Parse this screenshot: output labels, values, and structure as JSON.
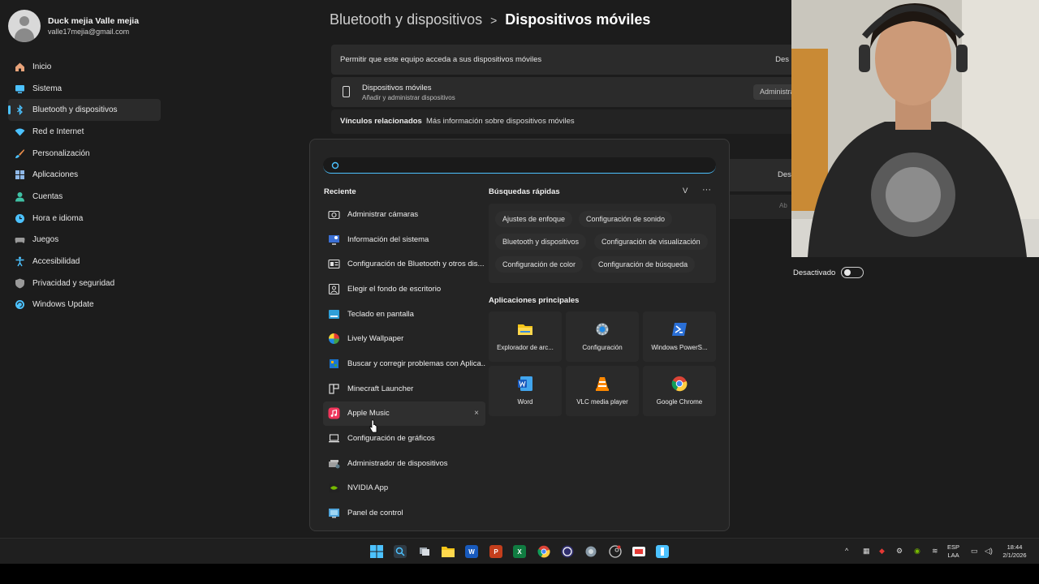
{
  "profile": {
    "name": "Duck mejia Valle mejia",
    "email": "valle17mejia@gmail.com"
  },
  "sidebar": {
    "items": [
      {
        "label": "Inicio",
        "icon": "home-icon",
        "color": "#e8a37a"
      },
      {
        "label": "Sistema",
        "icon": "system-icon",
        "color": "#4cc2ff"
      },
      {
        "label": "Bluetooth y dispositivos",
        "icon": "bluetooth-icon",
        "color": "#4cc2ff"
      },
      {
        "label": "Red e Internet",
        "icon": "wifi-icon",
        "color": "#4cc2ff"
      },
      {
        "label": "Personalización",
        "icon": "brush-icon",
        "color": "#e88c4a"
      },
      {
        "label": "Aplicaciones",
        "icon": "apps-icon",
        "color": "#8fb8e8"
      },
      {
        "label": "Cuentas",
        "icon": "account-icon",
        "color": "#3fc1a5"
      },
      {
        "label": "Hora e idioma",
        "icon": "globe-clock-icon",
        "color": "#4cc2ff"
      },
      {
        "label": "Juegos",
        "icon": "gamepad-icon",
        "color": "#9a9a9a"
      },
      {
        "label": "Accesibilidad",
        "icon": "accessibility-icon",
        "color": "#4cc2ff"
      },
      {
        "label": "Privacidad y seguridad",
        "icon": "shield-icon",
        "color": "#9a9a9a"
      },
      {
        "label": "Windows Update",
        "icon": "update-icon",
        "color": "#4cc2ff"
      }
    ]
  },
  "main": {
    "breadcrumb_parent": "Bluetooth y dispositivos",
    "breadcrumb_sep": ">",
    "title": "Dispositivos móviles",
    "allow_text": "Permitir que este equipo acceda a sus dispositivos móviles",
    "allow_state": "Des",
    "devices_title": "Dispositivos móviles",
    "devices_sub": "Añadir y administrar dispositivos",
    "manage_button": "Administrar",
    "related_label": "Vínculos relacionados",
    "related_link": "Más información sobre dispositivos móviles",
    "card_a_state": "Des",
    "card_b_text": "Ab",
    "deactivated": "Desactivado"
  },
  "search": {
    "placeholder": "",
    "recent_title": "Reciente",
    "recent": [
      {
        "label": "Administrar cámaras",
        "icon": "camera-icon"
      },
      {
        "label": "Información del sistema",
        "icon": "system-info-icon"
      },
      {
        "label": "Configuración de Bluetooth y otros dis...",
        "icon": "bluetooth-settings-icon"
      },
      {
        "label": "Elegir el fondo de escritorio",
        "icon": "wallpaper-icon"
      },
      {
        "label": "Teclado en pantalla",
        "icon": "keyboard-icon"
      },
      {
        "label": "Lively Wallpaper",
        "icon": "lively-icon"
      },
      {
        "label": "Buscar y corregir problemas con Aplica...",
        "icon": "troubleshoot-icon"
      },
      {
        "label": "Minecraft Launcher",
        "icon": "minecraft-icon"
      },
      {
        "label": "Apple Music",
        "icon": "apple-music-icon"
      },
      {
        "label": "Configuración de gráficos",
        "icon": "laptop-icon"
      },
      {
        "label": "Administrador de dispositivos",
        "icon": "device-manager-icon"
      },
      {
        "label": "NVIDIA App",
        "icon": "nvidia-icon"
      },
      {
        "label": "Panel de control",
        "icon": "control-panel-icon"
      }
    ],
    "remove_label": "×",
    "quick_title": "Búsquedas rápidas",
    "quick_v": "V",
    "quick_more": "···",
    "quick": [
      "Ajustes de enfoque",
      "Configuración de sonido",
      "Bluetooth y dispositivos",
      "Configuración de visualización",
      "Configuración de color",
      "Configuración de búsqueda"
    ],
    "apps_title": "Aplicaciones principales",
    "apps": [
      {
        "label": "Explorador de arc...",
        "icon": "file-explorer-icon"
      },
      {
        "label": "Configuración",
        "icon": "settings-gear-icon"
      },
      {
        "label": "Windows PowerS...",
        "icon": "powershell-icon"
      },
      {
        "label": "Word",
        "icon": "word-icon"
      },
      {
        "label": "VLC media player",
        "icon": "vlc-icon"
      },
      {
        "label": "Google Chrome",
        "icon": "chrome-icon"
      }
    ]
  },
  "taskbar": {
    "lang_top": "ESP",
    "lang_bottom": "LAA",
    "time": "18:44",
    "date": "2/1/2026",
    "word_letter": "W",
    "ppt_letter": "P",
    "excel_letter": "X"
  }
}
